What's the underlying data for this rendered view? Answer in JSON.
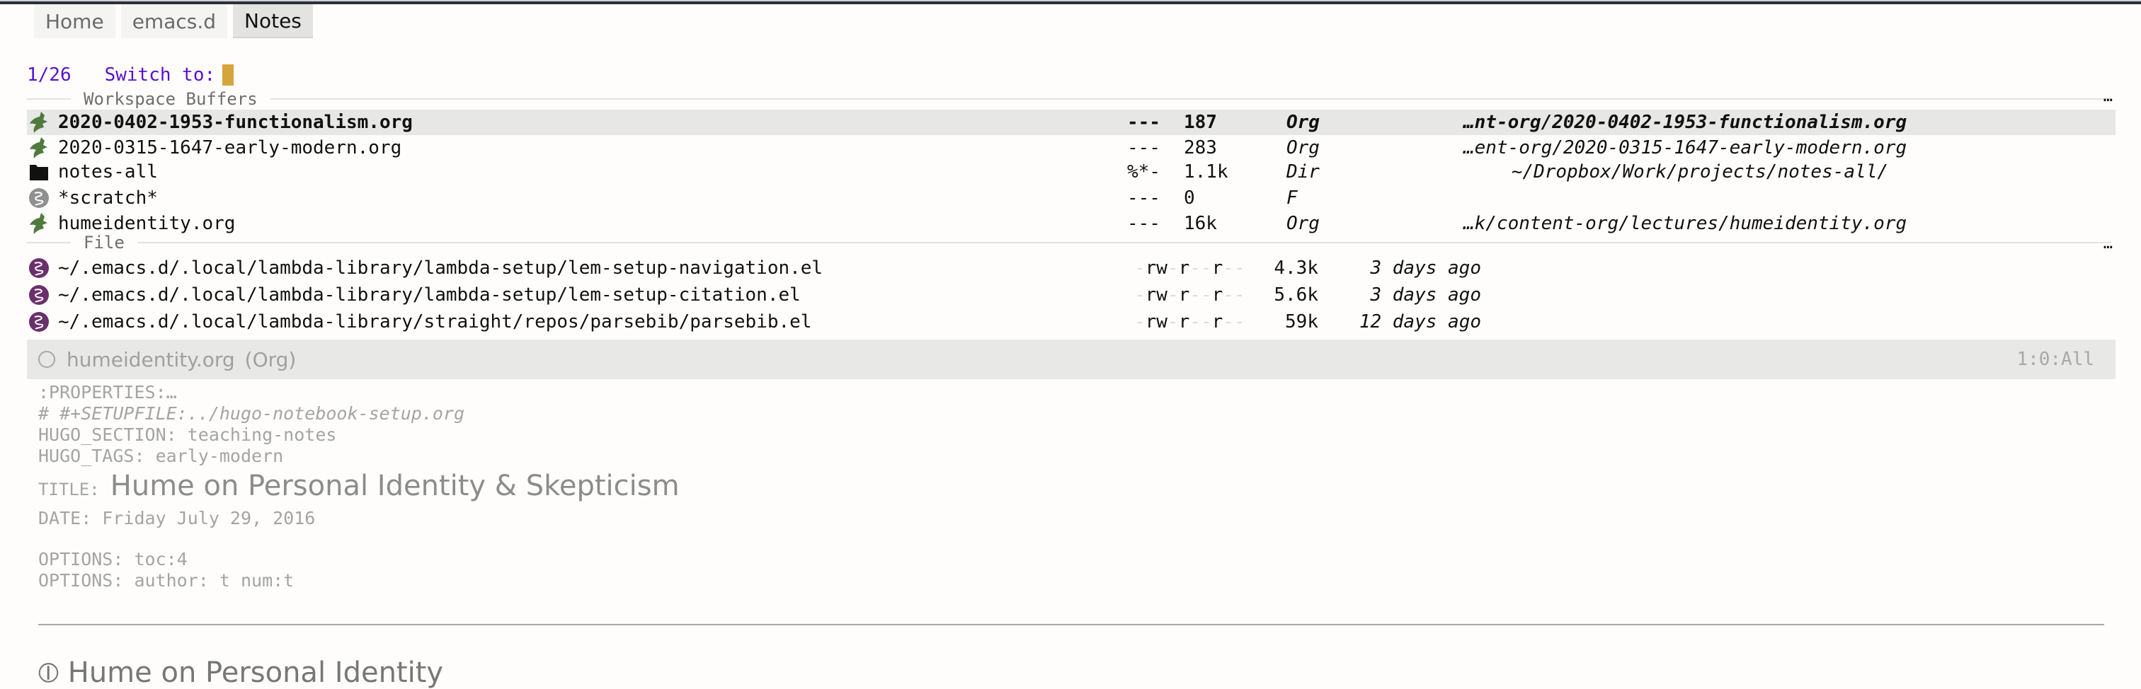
{
  "tabs": [
    {
      "label": "Home",
      "active": false
    },
    {
      "label": "emacs.d",
      "active": false
    },
    {
      "label": "Notes",
      "active": true
    }
  ],
  "minibuffer": {
    "count": "1/26",
    "prompt": "Switch to:",
    "input": ""
  },
  "workspace_buffers": {
    "title": "Workspace Buffers",
    "more_indicator": "…",
    "items": [
      {
        "icon": "org-unicorn-icon",
        "name": "2020-0402-1953-functionalism.org",
        "flags": "---",
        "size": "187",
        "mode": "Org",
        "path": "…nt-org/2020-0402-1953-functionalism.org",
        "selected": true
      },
      {
        "icon": "org-unicorn-icon",
        "name": "2020-0315-1647-early-modern.org",
        "flags": "---",
        "size": "283",
        "mode": "Org",
        "path": "…ent-org/2020-0315-1647-early-modern.org",
        "selected": false
      },
      {
        "icon": "folder-icon",
        "name": "notes-all",
        "flags": "%*-",
        "size": "1.1k",
        "mode": "Dir",
        "path": "~/Dropbox/Work/projects/notes-all/",
        "selected": false
      },
      {
        "icon": "emacs-icon",
        "name": "*scratch*",
        "flags": "---",
        "size": "0",
        "mode": "F",
        "path": "",
        "selected": false
      },
      {
        "icon": "org-unicorn-icon",
        "name": "humeidentity.org",
        "flags": "---",
        "size": "16k",
        "mode": "Org",
        "path": "…k/content-org/lectures/humeidentity.org",
        "selected": false
      }
    ]
  },
  "files": {
    "title": "File",
    "more_indicator": "…",
    "items": [
      {
        "icon": "elisp-icon",
        "path": "~/.emacs.d/.local/lambda-library/lambda-setup/lem-setup-navigation.el",
        "perm": "-rw-r--r--",
        "size": "4.3k",
        "modified": "3 days ago"
      },
      {
        "icon": "elisp-icon",
        "path": "~/.emacs.d/.local/lambda-library/lambda-setup/lem-setup-citation.el",
        "perm": "-rw-r--r--",
        "size": "5.6k",
        "modified": "3 days ago"
      },
      {
        "icon": "elisp-icon",
        "path": "~/.emacs.d/.local/lambda-library/straight/repos/parsebib/parsebib.el",
        "perm": "-rw-r--r--",
        "size": "59k",
        "modified": "12 days ago"
      }
    ]
  },
  "modeline": {
    "buffer": "humeidentity.org",
    "mode": "(Org)",
    "position": "1:0:All"
  },
  "document": {
    "properties": ":PROPERTIES:…",
    "setupfile": "# #+SETUPFILE:../hugo-notebook-setup.org",
    "hugo_section": "HUGO_SECTION: teaching-notes",
    "hugo_tags": "HUGO_TAGS: early-modern",
    "title_key": "TITLE:",
    "title": "Hume on Personal Identity & Skepticism",
    "date": "DATE: Friday July 29, 2016",
    "options1": "OPTIONS: toc:4",
    "options2": "OPTIONS: author: t num:t",
    "next_heading": "⦶ Hume on Personal Identity"
  },
  "colors": {
    "prompt": "#5a10d0",
    "cursor": "#d6a43a",
    "org_icon": "#4f7a3c",
    "elisp_icon": "#6b2f6b",
    "selected_row": "#e7e7e6"
  }
}
